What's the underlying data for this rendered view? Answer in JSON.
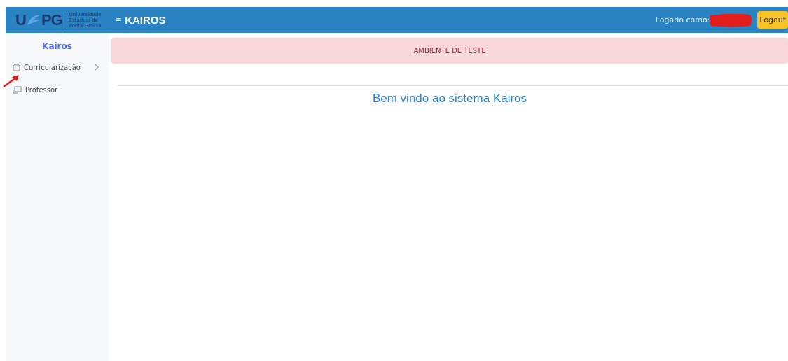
{
  "header": {
    "logo": {
      "left": "U",
      "right": "PG",
      "caption": [
        "Universidade",
        "Estadual de",
        "Ponta Grossa"
      ]
    },
    "menu_glyph": "≡",
    "title": "KAIROS",
    "logged_as": "Logado como:",
    "logout": "Logout"
  },
  "sidebar": {
    "title": "Kairos",
    "items": [
      {
        "label": "Curricularização",
        "kind": "submenu",
        "expanded": false
      },
      {
        "label": "Professor",
        "kind": "link"
      }
    ]
  },
  "alert": "AMBIENTE DE TESTE",
  "welcome": "Bem vindo ao sistema Kairos"
}
